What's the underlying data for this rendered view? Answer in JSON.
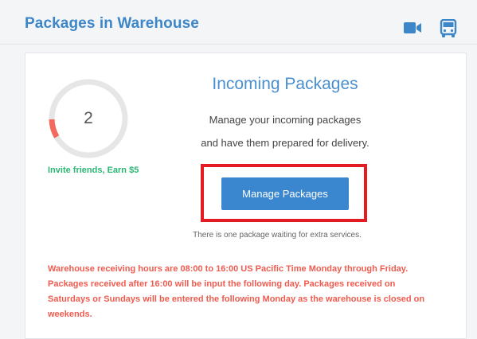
{
  "header": {
    "title": "Packages in Warehouse",
    "icons": [
      "video-camera-icon",
      "bus-icon"
    ],
    "accent_color": "#3d87c9"
  },
  "progress": {
    "count": "2",
    "fraction": 0.08,
    "track_color": "#e6e6e6",
    "fill_color": "#f4685e"
  },
  "invite": {
    "label": "Invite friends, Earn $5",
    "color": "#2bb673"
  },
  "incoming": {
    "title": "Incoming Packages",
    "description_line1": "Manage your incoming packages",
    "description_line2": "and have them prepared for delivery.",
    "button_label": "Manage Packages",
    "button_color": "#3a87cf",
    "status_note": "There is one package waiting for extra services."
  },
  "warning": {
    "lines": [
      "Warehouse receiving hours are 08:00 to 16:00 US Pacific Time Monday through Friday.",
      "Packages received after 16:00 will be input the following day. Packages received on",
      "Saturdays or Sundays will be entered the following Monday as the warehouse is closed on",
      "weekends."
    ],
    "color": "#f05b4f"
  },
  "highlight_color": "#e31b23"
}
